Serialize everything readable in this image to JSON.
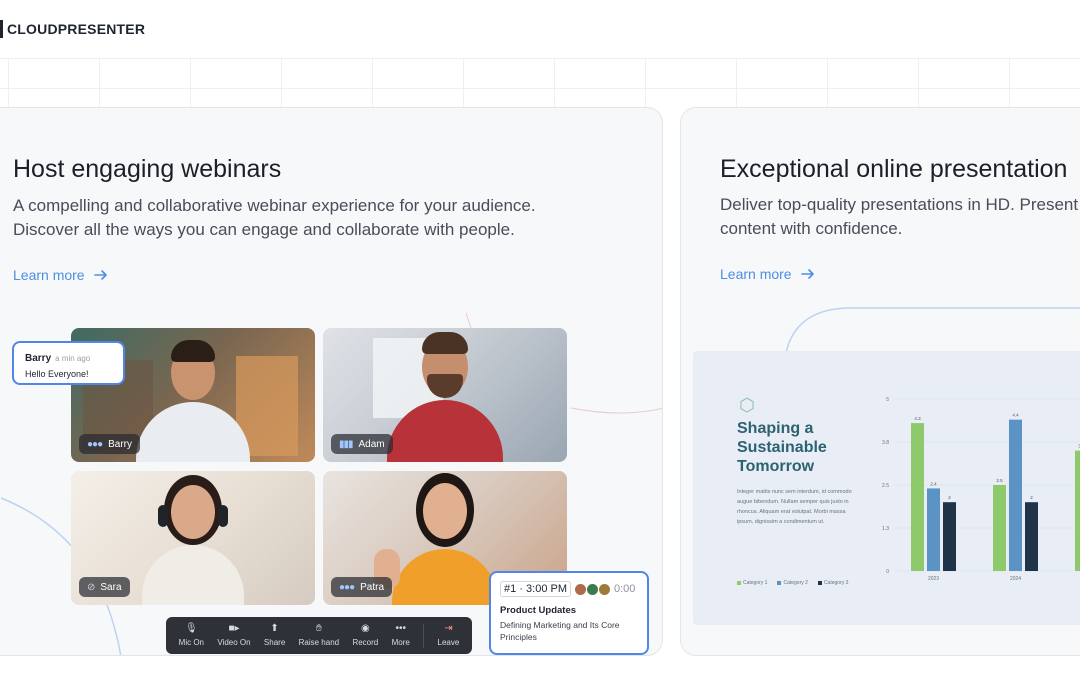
{
  "header": {
    "logo_text": "CLOUDPRESENTER"
  },
  "card1": {
    "title": "Host engaging webinars",
    "desc_line1": "A compelling and collaborative webinar experience for your audience.",
    "desc_line2": "Discover all the ways you can engage and collaborate with people.",
    "learn_more": "Learn more",
    "chat": {
      "name": "Barry",
      "time": "a min ago",
      "message": "Hello Everyone!"
    },
    "participants": [
      {
        "name": "Barry",
        "icon": "audio-dots-icon"
      },
      {
        "name": "Adam",
        "icon": "audio-wave-icon"
      },
      {
        "name": "Sara",
        "icon": "mic-muted-icon"
      },
      {
        "name": "Patra",
        "icon": "audio-dots-icon"
      }
    ],
    "toolbar": [
      {
        "label": "Mic On",
        "icon": "mic-icon"
      },
      {
        "label": "Video On",
        "icon": "video-icon"
      },
      {
        "label": "Share",
        "icon": "share-icon"
      },
      {
        "label": "Raise hand",
        "icon": "hand-icon"
      },
      {
        "label": "Record",
        "icon": "record-icon"
      },
      {
        "label": "More",
        "icon": "more-icon"
      },
      {
        "label": "Leave",
        "icon": "leave-icon"
      }
    ],
    "agenda": {
      "index": "#1 ·",
      "time": "3:00 PM",
      "elapsed": "0:00",
      "title": "Product Updates",
      "subtitle": "Defining Marketing and Its Core Principles"
    }
  },
  "card2": {
    "title": "Exceptional online presentation",
    "desc_line1": "Deliver top-quality presentations in HD. Present",
    "desc_line2": "content with confidence.",
    "learn_more": "Learn more",
    "slide": {
      "title_l1": "Shaping a",
      "title_l2": "Sustainable",
      "title_l3": "Tomorrow",
      "body": "Integer mattis nunc sem interdum, id commodo augue bibendum. Nullam semper quis justo in rhoncus. Aliquam erat volutpat. Morbi massa ipsum, dignissim a condimentum ut.",
      "legend": [
        "Category 1",
        "Category 2",
        "Category 3"
      ]
    }
  },
  "colors": {
    "accent": "#4f86e8",
    "link": "#4d8fe0",
    "bar_green": "#8ec96b",
    "bar_blue": "#5b93c4",
    "bar_navy": "#1f3448"
  },
  "chart_data": {
    "type": "bar",
    "categories": [
      "2023",
      "2024",
      ""
    ],
    "series": [
      {
        "name": "Category 1",
        "values": [
          4.3,
          2.5,
          3.5
        ]
      },
      {
        "name": "Category 2",
        "values": [
          2.4,
          4.4,
          null
        ]
      },
      {
        "name": "Category 3",
        "values": [
          2,
          2,
          null
        ]
      }
    ],
    "y_ticks": [
      "0",
      "1.3",
      "2.5",
      "3.8",
      "5"
    ],
    "ylim": [
      0,
      5
    ],
    "data_labels": true
  }
}
